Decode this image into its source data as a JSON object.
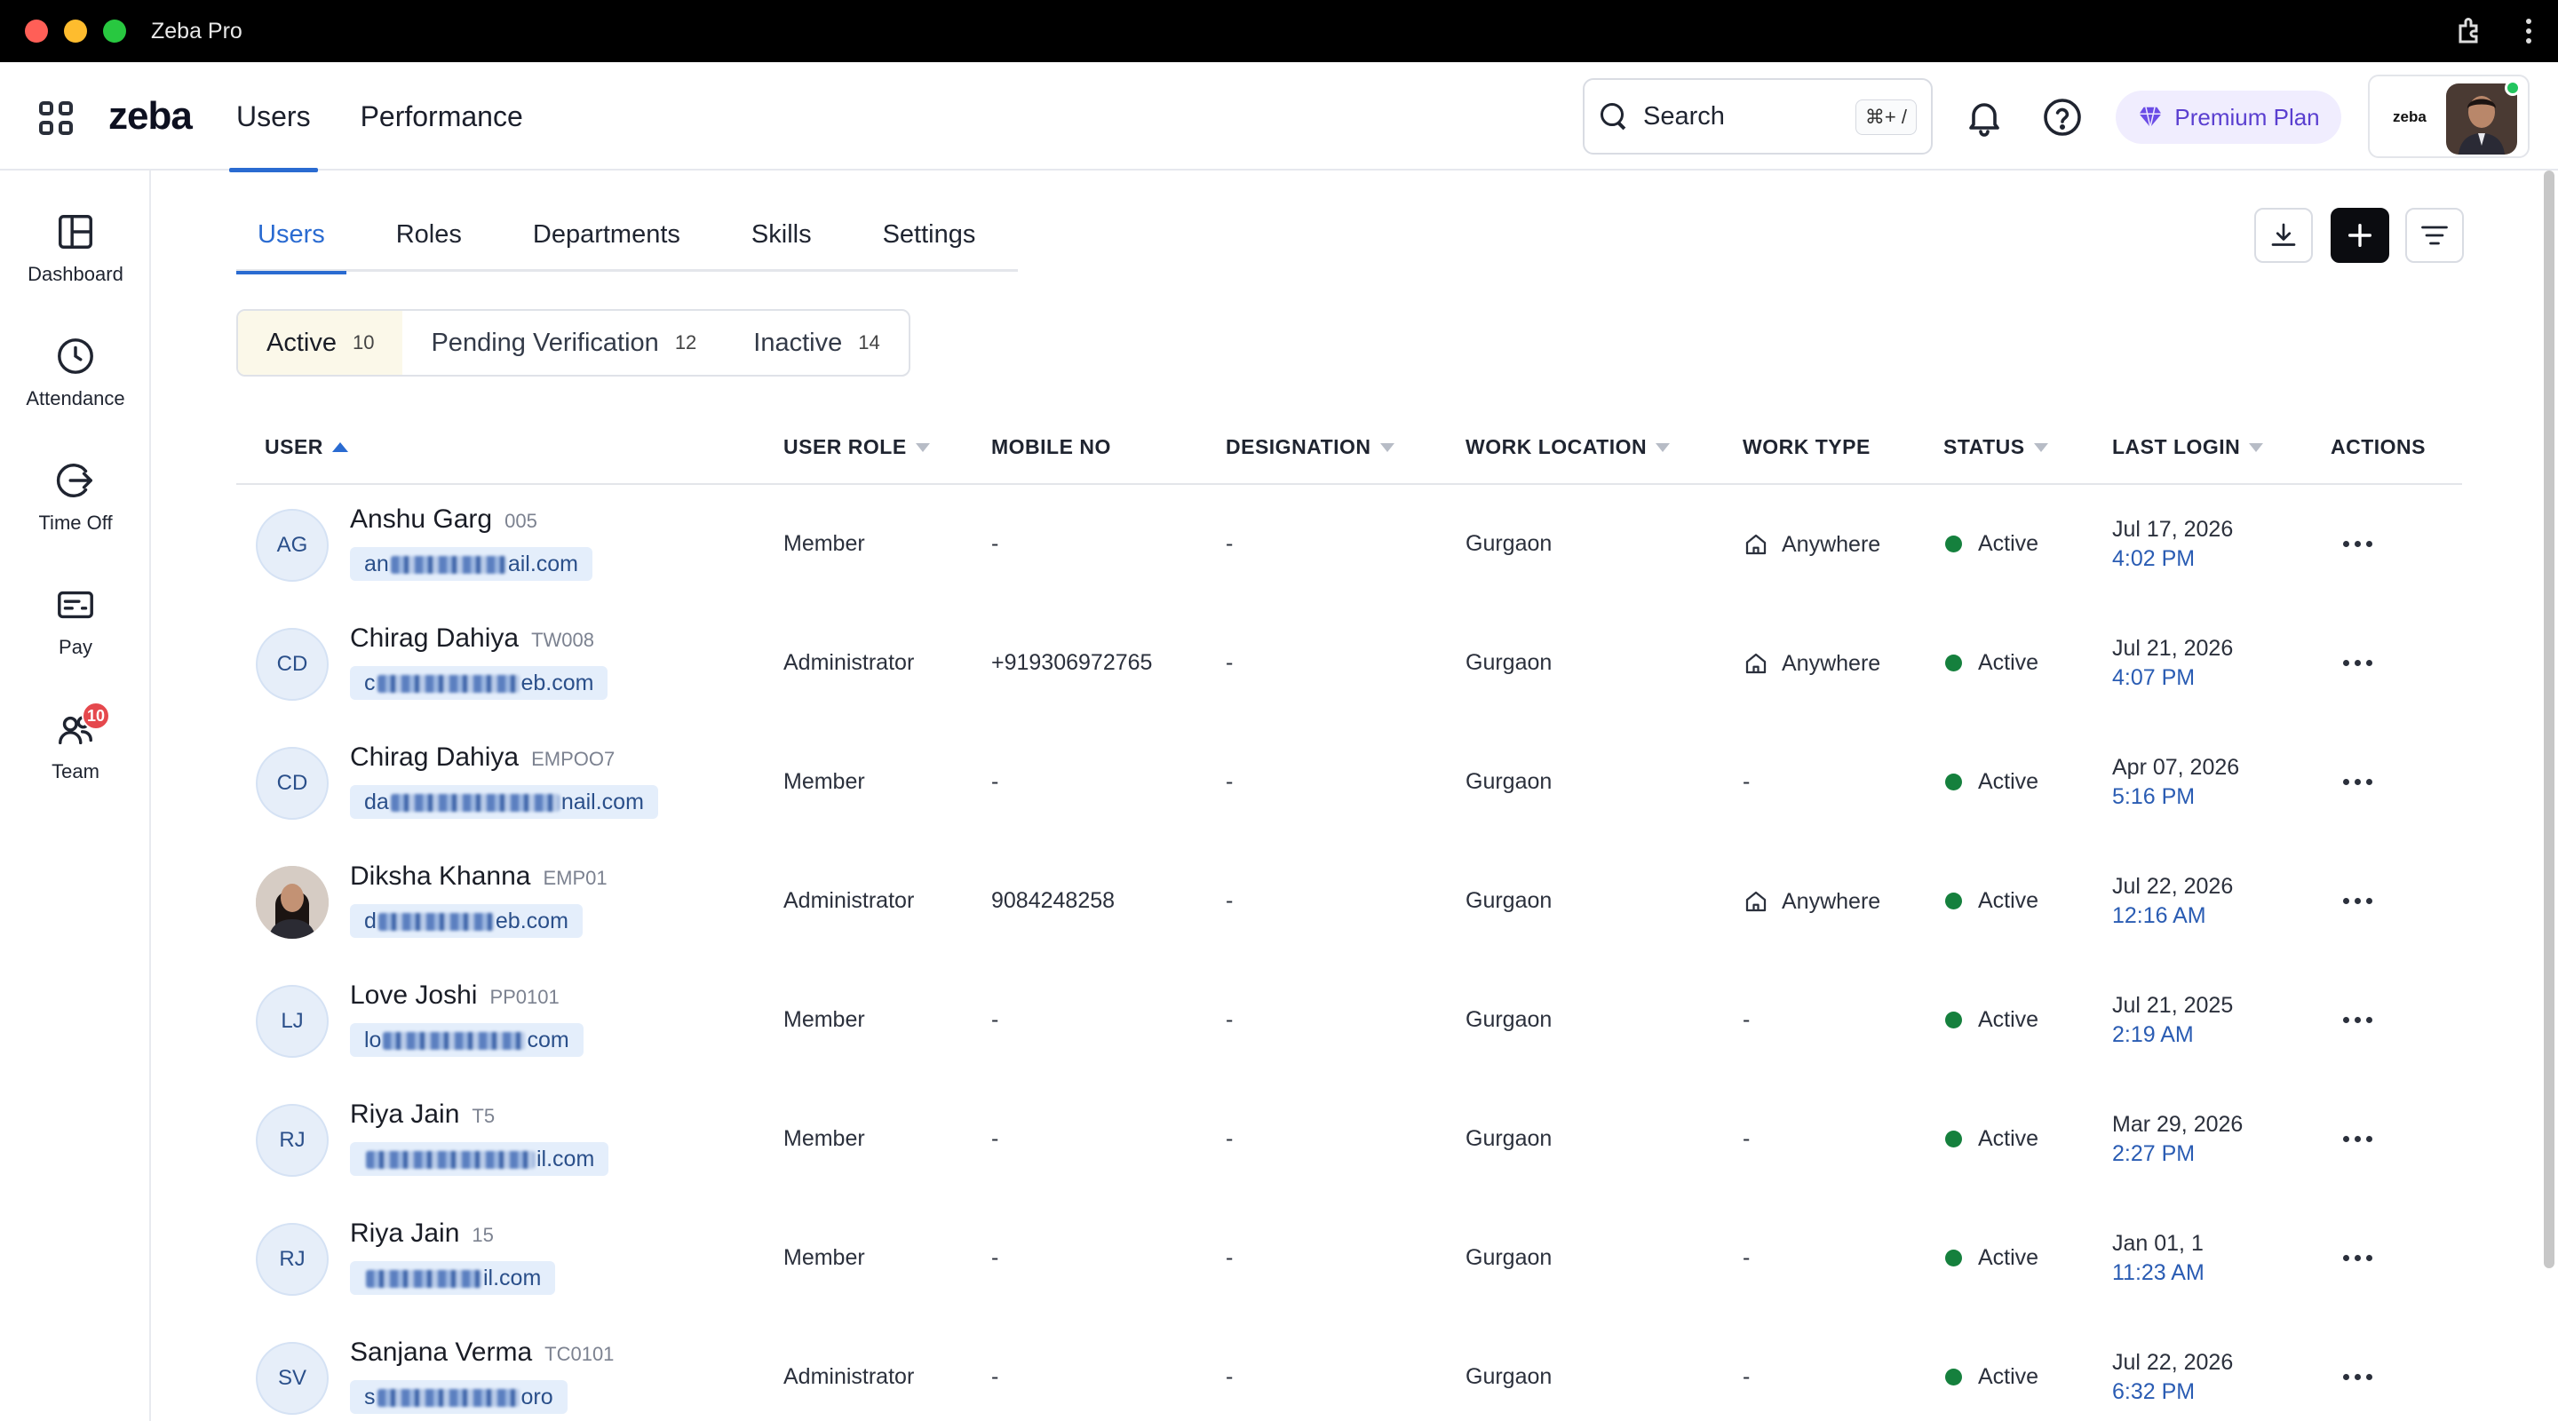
{
  "window": {
    "title": "Zeba Pro"
  },
  "header": {
    "logo": "zeba",
    "tabs": [
      {
        "label": "Users",
        "active": true
      },
      {
        "label": "Performance",
        "active": false
      }
    ],
    "search": {
      "label": "Search",
      "shortcut": "⌘+ /"
    },
    "premium_label": "Premium Plan",
    "account_logo": "zeba"
  },
  "sidebar": {
    "items": [
      {
        "label": "Dashboard",
        "icon": "dashboard-icon"
      },
      {
        "label": "Attendance",
        "icon": "clock-icon"
      },
      {
        "label": "Time Off",
        "icon": "logout-icon"
      },
      {
        "label": "Pay",
        "icon": "pay-icon"
      },
      {
        "label": "Team",
        "icon": "team-icon",
        "badge": "10"
      }
    ]
  },
  "sub_tabs": [
    {
      "label": "Users",
      "active": true
    },
    {
      "label": "Roles",
      "active": false
    },
    {
      "label": "Departments",
      "active": false
    },
    {
      "label": "Skills",
      "active": false
    },
    {
      "label": "Settings",
      "active": false
    }
  ],
  "filters": [
    {
      "label": "Active",
      "count": "10",
      "active": true
    },
    {
      "label": "Pending Verification",
      "count": "12",
      "active": false
    },
    {
      "label": "Inactive",
      "count": "14",
      "active": false
    }
  ],
  "table": {
    "columns": [
      "USER",
      "USER ROLE",
      "MOBILE NO",
      "DESIGNATION",
      "WORK LOCATION",
      "WORK TYPE",
      "STATUS",
      "LAST LOGIN",
      "ACTIONS"
    ],
    "rows": [
      {
        "initials": "AG",
        "name": "Anshu Garg",
        "code": "005",
        "email_start": "an",
        "email_end": "ail.com",
        "role": "Member",
        "mobile": "-",
        "designation": "-",
        "location": "Gurgaon",
        "work_type": "Anywhere",
        "status": "Active",
        "login_date": "Jul 17, 2026",
        "login_time": "4:02 PM"
      },
      {
        "initials": "CD",
        "name": "Chirag Dahiya",
        "code": "TW008",
        "email_start": "c",
        "email_end": "eb.com",
        "role": "Administrator",
        "mobile": "+919306972765",
        "designation": "-",
        "location": "Gurgaon",
        "work_type": "Anywhere",
        "status": "Active",
        "login_date": "Jul 21, 2026",
        "login_time": "4:07 PM"
      },
      {
        "initials": "CD",
        "name": "Chirag Dahiya",
        "code": "EMPOO7",
        "email_start": "da",
        "email_end": "nail.com",
        "role": "Member",
        "mobile": "-",
        "designation": "-",
        "location": "Gurgaon",
        "work_type": "-",
        "status": "Active",
        "login_date": "Apr 07, 2026",
        "login_time": "5:16 PM"
      },
      {
        "initials": "",
        "name": "Diksha Khanna",
        "code": "EMP01",
        "email_start": "d",
        "email_end": "eb.com",
        "role": "Administrator",
        "mobile": "9084248258",
        "designation": "-",
        "location": "Gurgaon",
        "work_type": "Anywhere",
        "status": "Active",
        "login_date": "Jul 22, 2026",
        "login_time": "12:16 AM"
      },
      {
        "initials": "LJ",
        "name": "Love Joshi",
        "code": "PP0101",
        "email_start": "lo",
        "email_end": "com",
        "role": "Member",
        "mobile": "-",
        "designation": "-",
        "location": "Gurgaon",
        "work_type": "-",
        "status": "Active",
        "login_date": "Jul 21, 2025",
        "login_time": "2:19 AM"
      },
      {
        "initials": "RJ",
        "name": "Riya Jain",
        "code": "T5",
        "email_start": "",
        "email_end": "il.com",
        "role": "Member",
        "mobile": "-",
        "designation": "-",
        "location": "Gurgaon",
        "work_type": "-",
        "status": "Active",
        "login_date": "Mar 29, 2026",
        "login_time": "2:27 PM"
      },
      {
        "initials": "RJ",
        "name": "Riya Jain",
        "code": "15",
        "email_start": "",
        "email_end": "il.com",
        "role": "Member",
        "mobile": "-",
        "designation": "-",
        "location": "Gurgaon",
        "work_type": "-",
        "status": "Active",
        "login_date": "Jan 01, 1",
        "login_time": "11:23 AM"
      },
      {
        "initials": "SV",
        "name": "Sanjana Verma",
        "code": "TC0101",
        "email_start": "s",
        "email_end": "oro",
        "role": "Administrator",
        "mobile": "-",
        "designation": "-",
        "location": "Gurgaon",
        "work_type": "-",
        "status": "Active",
        "login_date": "Jul 22, 2026",
        "login_time": "6:32 PM"
      }
    ]
  },
  "colors": {
    "accent": "#2a6bd1",
    "status_active": "#15803d",
    "premium": "#5a3fd0",
    "badge": "#e5484d"
  }
}
